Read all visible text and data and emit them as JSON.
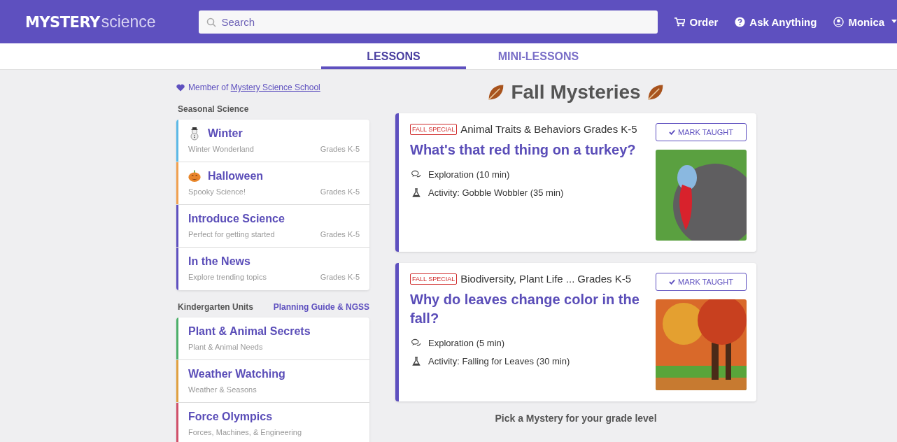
{
  "header": {
    "logo_bold": "MYSTERY",
    "logo_light": "science",
    "search": {
      "placeholder": "Search"
    },
    "nav": [
      {
        "kind": "cart",
        "label": "Order"
      },
      {
        "kind": "help",
        "label": "Ask Anything"
      },
      {
        "kind": "user",
        "label": "Monica"
      }
    ]
  },
  "tabs": [
    {
      "label": "LESSONS",
      "selected": true
    },
    {
      "label": "MINI-LESSONS",
      "selected": false
    }
  ],
  "sidebar": {
    "membership": {
      "prefix": "Member of ",
      "link": "Mystery Science School"
    },
    "sections": [
      {
        "title": "Seasonal Science",
        "items": [
          {
            "kind": "snowman",
            "title": "Winter",
            "subtitle": "Winter Wonderland",
            "grades": "Grades K-5",
            "color": "#5bb8e6"
          },
          {
            "kind": "pumpkin",
            "title": "Halloween",
            "subtitle": "Spooky Science!",
            "grades": "Grades K-5",
            "color": "#f0a050"
          },
          {
            "title": "Introduce Science",
            "subtitle": "Perfect for getting started",
            "grades": "Grades K-5",
            "color": "#5e50bf"
          },
          {
            "title": "In the News",
            "subtitle": "Explore trending topics",
            "grades": "Grades K-5",
            "color": "#5e50bf"
          }
        ]
      },
      {
        "title": "Kindergarten Units",
        "link": "Planning Guide & NGSS",
        "items": [
          {
            "title": "Plant & Animal Secrets",
            "subtitle": "Plant & Animal Needs",
            "color": "#4caf6a"
          },
          {
            "title": "Weather Watching",
            "subtitle": "Weather & Seasons",
            "color": "#e0a040"
          },
          {
            "title": "Force Olympics",
            "subtitle": "Forces, Machines, & Engineering",
            "color": "#d0506a"
          }
        ]
      }
    ]
  },
  "main": {
    "title": "Fall Mysteries",
    "cards": [
      {
        "tag": "FALL SPECIAL",
        "subject": "Animal Traits & Behaviors",
        "grades": "Grades K-5",
        "title": "What's that red thing on a turkey?",
        "button": "MARK TAUGHT",
        "kind": "turkey",
        "steps": [
          {
            "kind": "exploration",
            "text": "Exploration (10 min)"
          },
          {
            "kind": "activity",
            "text": "Activity: Gobble Wobbler (35 min)"
          }
        ]
      },
      {
        "tag": "FALL SPECIAL",
        "subject": "Biodiversity, Plant Life ...",
        "grades": "Grades K-5",
        "title": "Why do leaves change color in the fall?",
        "button": "MARK TAUGHT",
        "kind": "tree",
        "steps": [
          {
            "kind": "exploration",
            "text": "Exploration (5 min)"
          },
          {
            "kind": "activity",
            "text": "Activity: Falling for Leaves (30 min)"
          }
        ]
      }
    ],
    "footer": "Pick a Mystery for your grade level"
  }
}
